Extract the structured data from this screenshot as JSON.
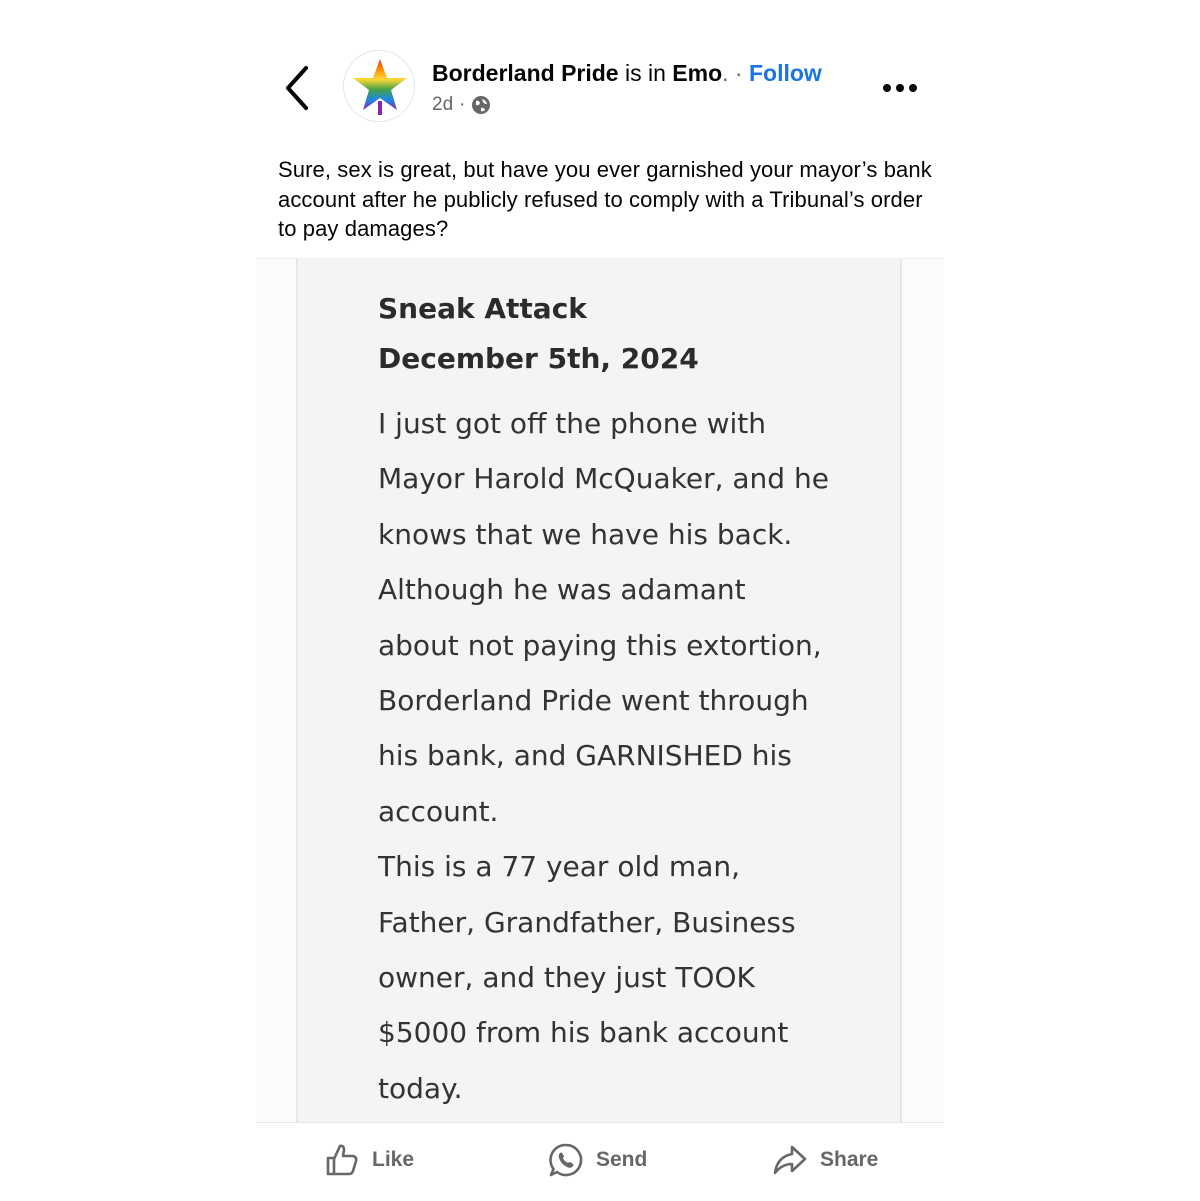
{
  "header": {
    "page_name": "Borderland Pride",
    "is_in_text": "is in",
    "location": "Emo",
    "separator": ". ·",
    "follow_label": "Follow",
    "time_ago": "2d",
    "meta_separator": "·",
    "audience_icon": "globe-icon",
    "back_icon": "chevron-left-icon",
    "more_icon": "more-dots-icon"
  },
  "caption": "Sure, sex is great, but have you ever garnished your mayor’s bank account after he publicly refused to comply with a Tribunal’s order to pay damages?",
  "image_post": {
    "title": "Sneak Attack",
    "date": "December 5th, 2024",
    "lines": [
      "I just got off the phone with",
      "Mayor Harold McQuaker, and he",
      "knows that we have his back.",
      "Although he was adamant",
      "about not paying this extortion,",
      "Borderland Pride went through",
      "his bank, and GARNISHED his",
      "account.",
      "This is a 77 year old man,",
      "Father, Grandfather, Business",
      "owner, and they just TOOK",
      "$5000 from his bank account",
      "today."
    ]
  },
  "actions": {
    "like_label": "Like",
    "send_label": "Send",
    "share_label": "Share"
  },
  "colors": {
    "link_blue": "#1b74e4",
    "secondary_text": "#65676b",
    "doc_background": "#f4f4f4"
  }
}
